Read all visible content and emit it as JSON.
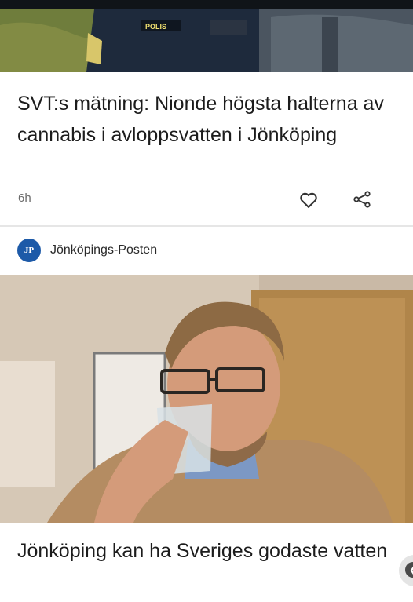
{
  "article1": {
    "headline": "SVT:s mätning: Nionde högsta halterna av cannabis i avloppsvatten i Jönköping",
    "time": "6h",
    "image": {
      "badge_text": "POLIS"
    },
    "actions": {
      "like_icon": "heart-icon",
      "share_icon": "share-icon"
    }
  },
  "article2": {
    "source": {
      "logo_text": "JP",
      "name": "Jönköpings-Posten",
      "logo_color": "#1d5aa8"
    },
    "headline": "Jönköping kan ha Sveriges godaste vatten"
  }
}
